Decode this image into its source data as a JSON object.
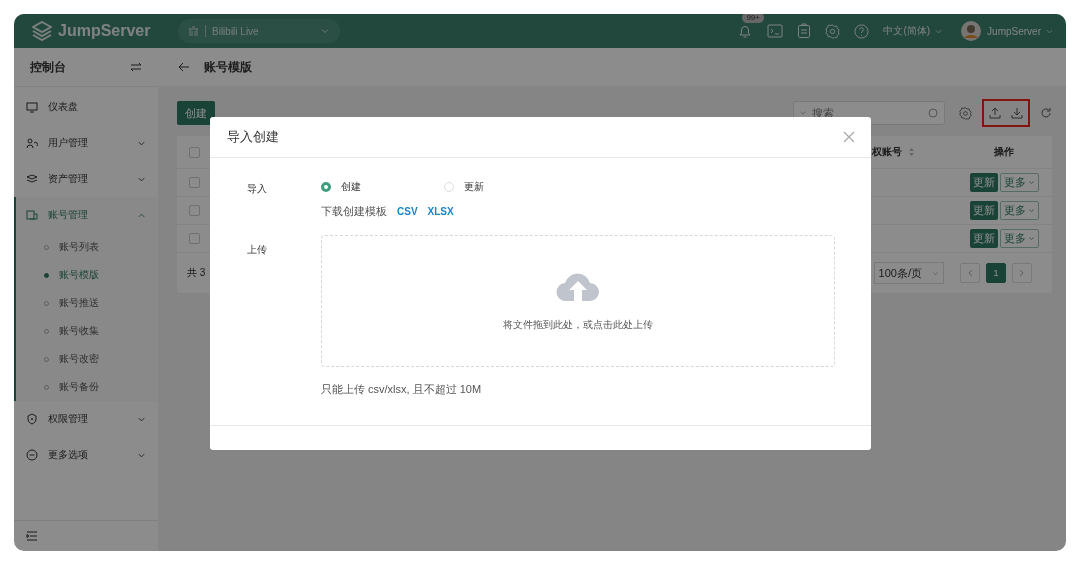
{
  "header": {
    "logo": "JumpServer",
    "org": "Bilibili Live",
    "badge": "99+",
    "language": "中文(简体)",
    "user": "JumpServer"
  },
  "sidebar": {
    "title": "控制台",
    "items": [
      {
        "label": "仪表盘",
        "kind": "dashboard",
        "selected": false
      },
      {
        "label": "用户管理",
        "kind": "users",
        "selected": false,
        "expanded": false
      },
      {
        "label": "资产管理",
        "kind": "assets",
        "selected": false,
        "expanded": false
      },
      {
        "label": "账号管理",
        "kind": "accounts",
        "selected": true,
        "expanded": true,
        "children": [
          {
            "label": "账号列表",
            "selected": false
          },
          {
            "label": "账号模版",
            "selected": true
          },
          {
            "label": "账号推送",
            "selected": false
          },
          {
            "label": "账号收集",
            "selected": false
          },
          {
            "label": "账号改密",
            "selected": false
          },
          {
            "label": "账号备份",
            "selected": false
          }
        ]
      },
      {
        "label": "权限管理",
        "kind": "perms",
        "selected": false,
        "expanded": false
      },
      {
        "label": "更多选项",
        "kind": "more",
        "selected": false,
        "expanded": false
      }
    ]
  },
  "breadcrumb": {
    "title": "账号模版"
  },
  "toolbar": {
    "create": "创建",
    "search_placeholder": "搜索"
  },
  "table": {
    "columns": [
      {
        "label": "权账号",
        "sortable": true
      },
      {
        "label": "操作",
        "sortable": false
      }
    ],
    "header_checked": false,
    "rows": [
      {
        "checked": false,
        "actions": [
          "更新",
          "更多"
        ]
      },
      {
        "checked": false,
        "actions": [
          "更新",
          "更多"
        ]
      },
      {
        "checked": false,
        "actions": [
          "更新",
          "更多"
        ]
      }
    ],
    "total": "共 3",
    "page_size": "100条/页",
    "pages": [
      {
        "label": "1",
        "selected": true
      }
    ]
  },
  "dialog": {
    "title": "导入创建",
    "import_label": "导入",
    "options": [
      {
        "label": "创建",
        "selected": true
      },
      {
        "label": "更新",
        "selected": false
      }
    ],
    "template_text": "下载创建模板",
    "template_links": [
      "CSV",
      "XLSX"
    ],
    "upload_label": "上传",
    "drop_text": "将文件拖到此处，或点击此处上传",
    "hint": "只能上传 csv/xlsx, 且不超过 10M"
  }
}
